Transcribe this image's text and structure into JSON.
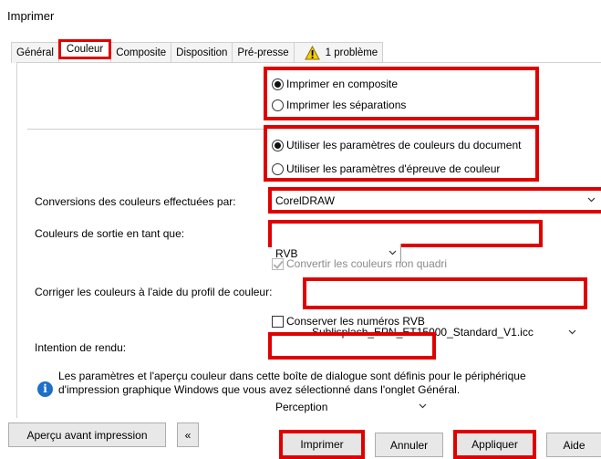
{
  "window": {
    "title": "Imprimer"
  },
  "tabs": [
    {
      "label": "Général"
    },
    {
      "label": "Couleur"
    },
    {
      "label": "Composite"
    },
    {
      "label": "Disposition"
    },
    {
      "label": "Pré-presse"
    },
    {
      "label": "1 problème",
      "icon": "warning-icon"
    }
  ],
  "output_mode": {
    "composite": "Imprimer en composite",
    "separations": "Imprimer les séparations",
    "selected": "composite"
  },
  "color_settings": {
    "document": "Utiliser les paramètres de couleurs du document",
    "proof": "Utiliser les paramètres d'épreuve de couleur",
    "selected": "document"
  },
  "conversions": {
    "label": "Conversions des couleurs effectuées par:",
    "value": "CorelDRAW"
  },
  "output_colors": {
    "label": "Couleurs de sortie en tant que:",
    "value": "RVB"
  },
  "convert_non_cmyk": {
    "label": "Convertir les couleurs non quadri",
    "checked": true,
    "enabled": false
  },
  "profile": {
    "label": "Corriger les couleurs à l'aide du profil de couleur:",
    "value": "Sublisplash_EPN_ET15000_Standard_V1.icc"
  },
  "keep_rgb": {
    "label": "Conserver les numéros RVB",
    "checked": false
  },
  "rendering_intent": {
    "label": "Intention de rendu:",
    "value": "Perception"
  },
  "info": {
    "line1": "Les paramètres et l'aperçu couleur dans cette boîte de dialogue sont définis pour le périphérique",
    "line2": "d'impression graphique Windows que vous avez sélectionné dans l'onglet Général."
  },
  "buttons": {
    "preview": "Aperçu avant impression",
    "collapse": "«",
    "print": "Imprimer",
    "cancel": "Annuler",
    "apply": "Appliquer",
    "help": "Aide"
  },
  "colors": {
    "highlight": "#e00000",
    "info": "#1e6fc8"
  }
}
